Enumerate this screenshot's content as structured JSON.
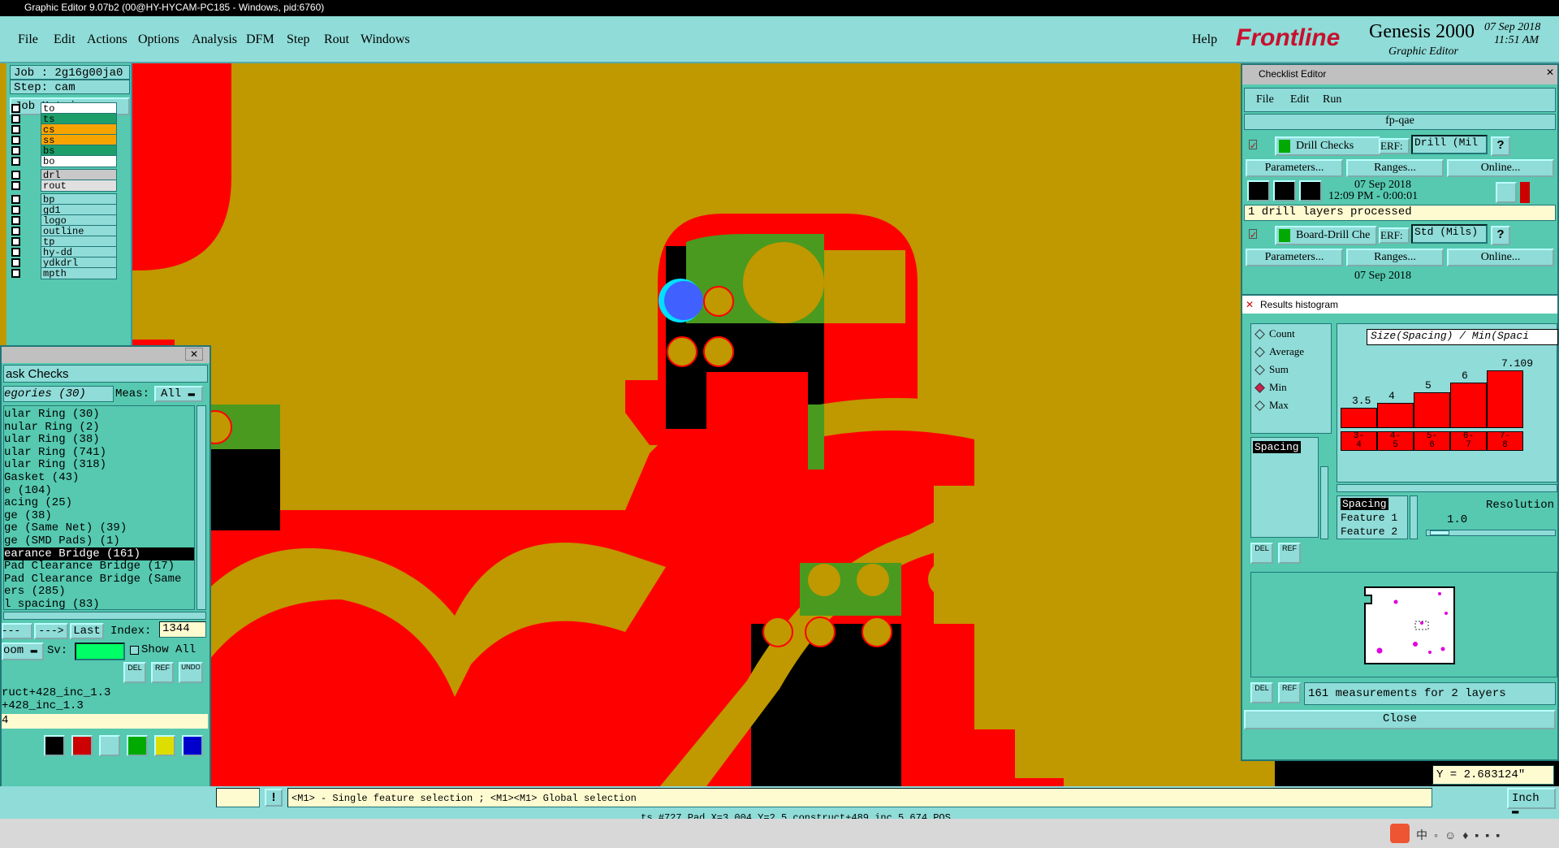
{
  "window": {
    "title": "Graphic Editor 9.07b2 (00@HY-HYCAM-PC185 - Windows, pid:6760)"
  },
  "menu": {
    "items": [
      "File",
      "Edit",
      "Actions",
      "Options",
      "Analysis",
      "DFM",
      "Step",
      "Rout",
      "Windows"
    ],
    "help": "Help"
  },
  "brand": {
    "logo": "Frontline",
    "product": "Genesis 2000",
    "subtitle": "Graphic Editor",
    "date": "07 Sep 2018",
    "time": "11:51 AM"
  },
  "job": {
    "job": "Job : 2g16g00ja0",
    "step": "Step: cam",
    "matrix": "Job Matrix ..."
  },
  "layers": [
    {
      "name": "to",
      "color": "#ffffff"
    },
    {
      "name": "ts",
      "color": "#1e9e6a"
    },
    {
      "name": "cs",
      "color": "#f7a400"
    },
    {
      "name": "ss",
      "color": "#f7a400"
    },
    {
      "name": "bs",
      "color": "#1e9e6a"
    },
    {
      "name": "bo",
      "color": "#ffffff"
    },
    {
      "name": "drl",
      "color": "#c8c8c8"
    },
    {
      "name": "rout",
      "color": "#e0e0e0"
    },
    {
      "name": "bp",
      "color": "#8fdcd8"
    },
    {
      "name": "gd1",
      "color": "#8fdcd8"
    },
    {
      "name": "logo",
      "color": "#8fdcd8"
    },
    {
      "name": "outline",
      "color": "#8fdcd8"
    },
    {
      "name": "tp",
      "color": "#8fdcd8"
    },
    {
      "name": "hy-dd",
      "color": "#8fdcd8"
    },
    {
      "name": "ydkdrl",
      "color": "#8fdcd8"
    },
    {
      "name": "mpth",
      "color": "#8fdcd8"
    }
  ],
  "dfm": {
    "title": "ask Checks",
    "categories": "egories (30)",
    "meas_label": "Meas:",
    "meas_value": "All",
    "rows": [
      "ular Ring (30)",
      "nular Ring (2)",
      "ular Ring (38)",
      "ular Ring (741)",
      "ular Ring (318)",
      " Gasket (43)",
      "e (104)",
      "acing (25)",
      "ge (38)",
      "ge (Same Net) (39)",
      "ge (SMD Pads) (1)",
      "earance Bridge (161)",
      "Pad Clearance Bridge (17)",
      "Pad Clearance Bridge (Same",
      "ers (285)",
      "l spacing (83)"
    ],
    "selected_index": 11,
    "prev": "<---",
    "next": "--->",
    "last": "Last",
    "index_label": "Index:",
    "index_value": "1344",
    "zoom": "oom",
    "sv": "Sv:",
    "show_all": "Show All",
    "del": "DEL",
    "ref": "REF",
    "undo": "UNDO",
    "info1": "ruct+428_inc_1.3",
    "info2": "+428_inc_1.3",
    "info3": "4"
  },
  "checklist": {
    "title": "Checklist Editor",
    "menu": [
      "File",
      "Edit",
      "Run"
    ],
    "name": "fp-qae",
    "checks": [
      {
        "name": "Drill Checks",
        "erf_label": "ERF:",
        "erf_value": "Drill (Mil",
        "help": "?",
        "params": "Parameters...",
        "ranges": "Ranges...",
        "online": "Online...",
        "date": "07 Sep 2018",
        "time": "12:09 PM - 0:00:01",
        "status": "1 drill layers processed"
      },
      {
        "name": "Board-Drill Che",
        "erf_label": "ERF:",
        "erf_value": "Std (Mils)",
        "help": "?",
        "params": "Parameters...",
        "ranges": "Ranges...",
        "online": "Online...",
        "date": "07 Sep 2018"
      }
    ]
  },
  "histogram": {
    "title": "Results histogram",
    "modes": [
      "Count",
      "Average",
      "Sum",
      "Min",
      "Max"
    ],
    "selected_mode": "Min",
    "list_item": "Spacing",
    "chart_title": "Size(Spacing) / Min(Spaci",
    "bar_values": [
      "3.5",
      "4",
      "5",
      "6",
      "7.109"
    ],
    "bins": [
      [
        "3-",
        "4"
      ],
      [
        "4-",
        "5"
      ],
      [
        "5-",
        "6"
      ],
      [
        "6-",
        "7"
      ],
      [
        "7-",
        "8"
      ]
    ],
    "legend": [
      "Spacing",
      "Feature 1",
      "Feature 2"
    ],
    "resolution_label": "Resolution",
    "resolution_value": "1.0",
    "summary": "161 measurements for 2 layers",
    "close": "Close",
    "del": "DEL",
    "ref": "REF"
  },
  "status": {
    "hint": "<M1> - Single feature selection ; <M1><M1> Global selection",
    "y_coord": "Y = 2.683124\"",
    "units": "Inch",
    "feature": "ts,#727,Pad,X=3.004,Y=2.5,construct+489_inc_5.674,POS"
  },
  "colors": {
    "board": "#c09800",
    "copper": "#ff0000",
    "green": "#4a9a1f",
    "highlight": "#4060ff",
    "panel": "#56c9b0",
    "panel_light": "#8fdcd8"
  }
}
